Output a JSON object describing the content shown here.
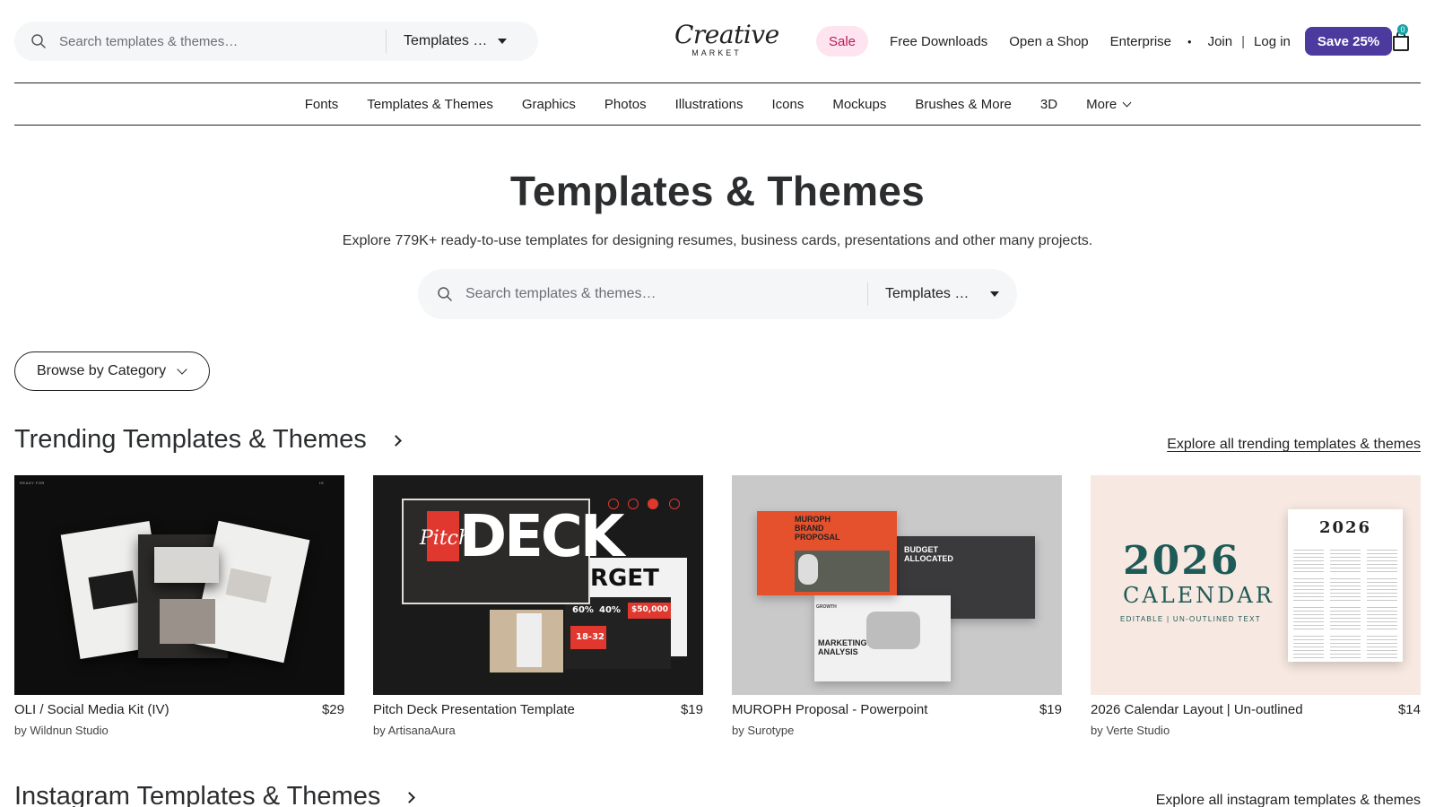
{
  "header": {
    "search": {
      "placeholder": "Search templates & themes…",
      "select_value": "Templates …"
    },
    "logo": {
      "script": "Creative",
      "sub": "MARKET"
    },
    "nav": {
      "sale": "Sale",
      "free_downloads": "Free Downloads",
      "open_shop": "Open a Shop",
      "enterprise": "Enterprise",
      "dot": "•",
      "join": "Join",
      "separator": "|",
      "login": "Log in",
      "save_button": "Save 25%",
      "cart_count": "0"
    }
  },
  "categories": [
    "Fonts",
    "Templates & Themes",
    "Graphics",
    "Photos",
    "Illustrations",
    "Icons",
    "Mockups",
    "Brushes & More",
    "3D",
    "More"
  ],
  "hero": {
    "title": "Templates & Themes",
    "subtitle": "Explore 779K+ ready-to-use templates for designing resumes, business cards, presentations and other many projects.",
    "search": {
      "placeholder": "Search templates & themes…",
      "select_value": "Templates …"
    }
  },
  "browse_button": "Browse by Category",
  "trending": {
    "title": "Trending Templates & Themes",
    "explore": "Explore all trending templates & themes",
    "products": [
      {
        "name": "OLI / Social Media Kit (IV)",
        "price": "$29",
        "author": "by Wildnun Studio"
      },
      {
        "name": "Pitch Deck Presentation Template",
        "price": "$19",
        "author": "by ArtisanaAura"
      },
      {
        "name": "MUROPH Proposal - Powerpoint",
        "price": "$19",
        "author": "by Surotype"
      },
      {
        "name": "2026 Calendar Layout | Un-outlined",
        "price": "$14",
        "author": "by Verte Studio"
      }
    ]
  },
  "thumbs": {
    "t2": {
      "big_word": "DECK",
      "script_word": "Pitch",
      "side_word": "RGET",
      "pct_a": "60%",
      "pct_b": "40%",
      "amount": "$50,000",
      "age": "18-32"
    },
    "t3": {
      "brand": "MUROPH BRAND PROPOSAL",
      "budget": "BUDGET ALLOCATED",
      "marketing": "MARKETING ANALYSIS",
      "growth": "GROWTH"
    },
    "t4": {
      "year": "2026",
      "calendar": "CALENDAR",
      "editable": "EDITABLE | UN-OUTLINED TEXT",
      "poster_year": "2026"
    }
  },
  "instagram": {
    "title": "Instagram Templates & Themes",
    "explore": "Explore all instagram templates & themes"
  },
  "colors": {
    "accent": "#4d3a9e",
    "sale_bg": "#fde4ee",
    "sale_text": "#c0185d",
    "cart_badge": "#17a2a6"
  }
}
